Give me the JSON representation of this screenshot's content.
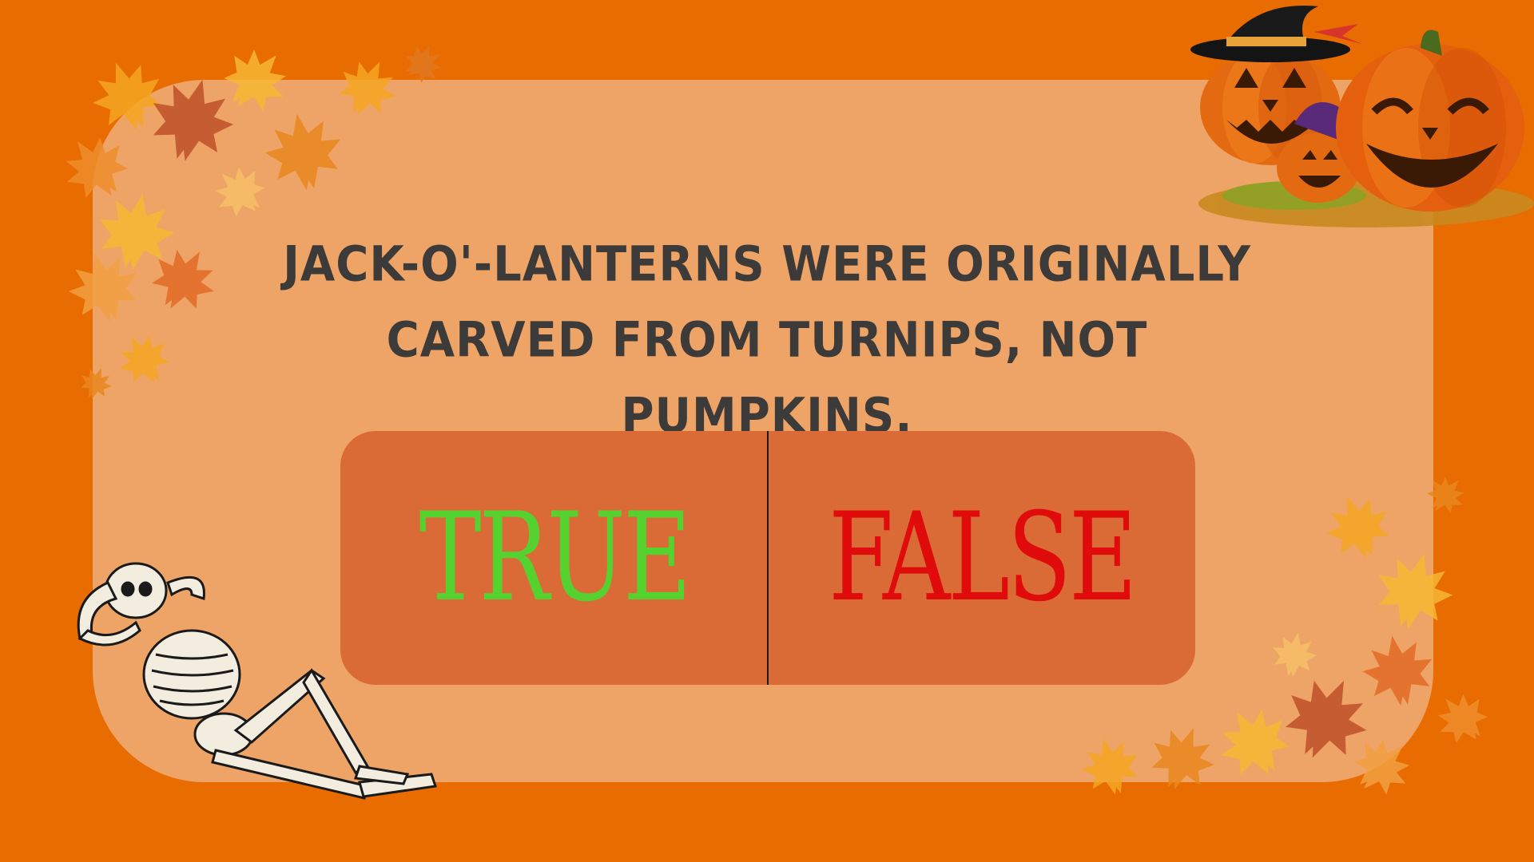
{
  "question": {
    "text": "JACK-O'-LANTERNS WERE ORIGINALLY CARVED FROM TURNIPS, NOT PUMPKINS."
  },
  "answers": {
    "true_label": "TRUE",
    "false_label": "FALSE"
  },
  "colors": {
    "background": "#e86c00",
    "card": "#eea466",
    "answer_panel": "#db6b36",
    "true_text": "#55d22f",
    "false_text": "#e00c0c",
    "question_text": "#3d3a3a"
  },
  "decorations": [
    "maple-leaves-icon",
    "jack-o-lantern-icon",
    "witch-hat-icon",
    "skeleton-icon"
  ]
}
